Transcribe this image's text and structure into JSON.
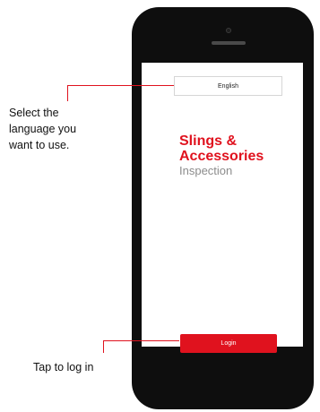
{
  "screen": {
    "language_select": {
      "value": "English"
    },
    "app_title": {
      "line1": "Slings &",
      "line2": "Accessories",
      "subtitle": "Inspection"
    },
    "login_button": {
      "label": "Login"
    }
  },
  "annotations": {
    "language": {
      "line1": "Select the",
      "line2": "language you",
      "line3": "want to use."
    },
    "login": {
      "text": "Tap to log in"
    }
  },
  "colors": {
    "accent": "#e0121e",
    "phone_body": "#0e0e0e",
    "subtitle": "#8c8c8c"
  }
}
